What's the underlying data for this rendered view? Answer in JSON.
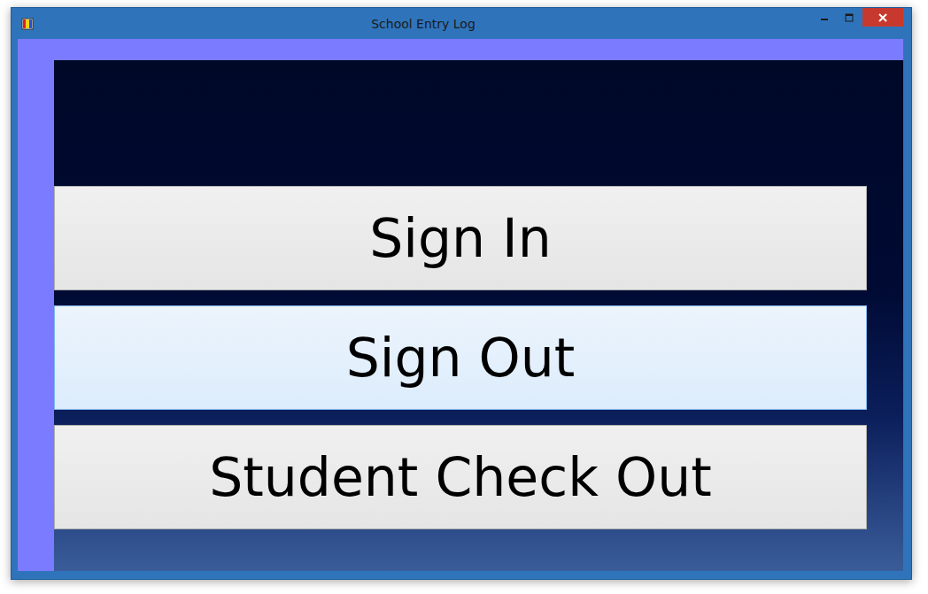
{
  "window": {
    "title": "School Entry Log"
  },
  "buttons": [
    {
      "label": "Sign In",
      "highlighted": false
    },
    {
      "label": "Sign Out",
      "highlighted": true
    },
    {
      "label": "Student Check Out",
      "highlighted": false
    }
  ]
}
